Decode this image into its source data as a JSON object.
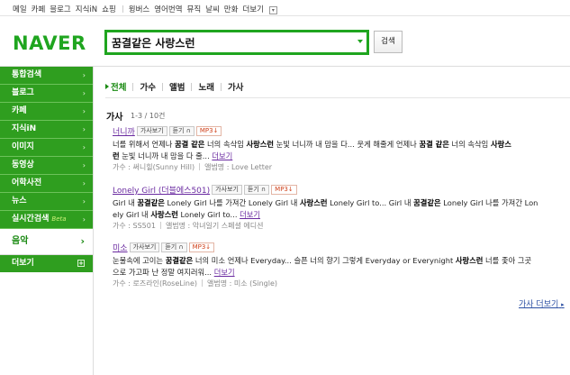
{
  "topbar": {
    "links": [
      "메일",
      "카페",
      "블로그",
      "지식iN",
      "쇼핑"
    ],
    "links2": [
      "윙버스",
      "영어번역",
      "뮤직",
      "날씨",
      "만화",
      "더보기"
    ],
    "more_icon": "chevron-down-icon"
  },
  "header": {
    "logo": "NAVER",
    "search_value": "꿈결같은 사랑스런",
    "search_button": "검색"
  },
  "sidebar": {
    "items": [
      {
        "label": "통합검색"
      },
      {
        "label": "블로그"
      },
      {
        "label": "카페"
      },
      {
        "label": "지식iN"
      },
      {
        "label": "이미지"
      },
      {
        "label": "동영상"
      },
      {
        "label": "어학사전"
      },
      {
        "label": "뉴스"
      },
      {
        "label": "실시간검색",
        "badge": "Beta"
      }
    ],
    "active": "음악",
    "more": "더보기",
    "accent": "#2f9e1f"
  },
  "tabs": [
    "전체",
    "가수",
    "앨범",
    "노래",
    "가사"
  ],
  "section": {
    "title": "가사",
    "count": "1-3 / 10건"
  },
  "buttons": {
    "lyrics": "가사보기",
    "listen": "듣기",
    "mp3": "MP3"
  },
  "results": [
    {
      "title": "너니까",
      "lyric_html": "너를 위해서 언제나 <b>꿈결 같은</b> 너의 속삭임 <b>사랑스런</b> 눈빛 너니까 내 맘을 다... 웃게 해줄게 언제나 <b>꿈결 같은</b> 너의 속삭임 <b>사랑스</b><br><b>런</b> 눈빛 너니까 내 맘을 다 줄...",
      "more": "더보기",
      "artist_label": "가수 : 써니힐(Sunny Hill)",
      "album_label": "앨범명 : Love Letter"
    },
    {
      "title": "Lonely Girl (더블에스501)",
      "lyric_html": "Girl 내 <b>꿈결같은</b> Lonely Girl 나를 가져간 Lonely Girl 내 <b>사랑스런</b> Lonely Girl to... Girl 내 <b>꿈결같은</b> Lonely Girl 나를 가져간 Lon<br>ely Girl 내 <b>사랑스런</b> Lonely Girl to...",
      "more": "더보기",
      "artist_label": "가수 : SS501",
      "album_label": "앨범명 : 악녀일기 스페셜 에디션"
    },
    {
      "title": "미소",
      "lyric_html": "눈물속에 고이는 <b>꿈결같은</b> 너의 미소 언제나 Everyday... 슬픈 너의 향기 그렇게 Everyday or Everynight <b>사랑스런</b> 너를 좇아 그곳<br>으로 가고파 난 정말 여지러워...",
      "more": "더보기",
      "artist_label": "가수 : 로즈라인(RoseLine)",
      "album_label": "앨범명 : 미소 (Single)"
    }
  ],
  "lyrics_more": "가사 더보기"
}
